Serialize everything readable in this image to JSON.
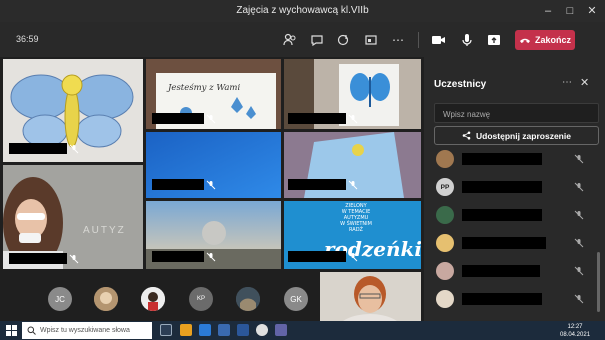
{
  "window": {
    "title": "Zajęcia z wychowawcą kl.VIIb"
  },
  "meeting": {
    "elapsed": "36:59",
    "leave_label": "Zakończ"
  },
  "panel": {
    "title": "Uczestnicy",
    "search_placeholder": "Wpisz nazwę",
    "share_label": "Udostępnij zaproszenie",
    "participants": [
      {
        "initials": ""
      },
      {
        "initials": "PP"
      },
      {
        "initials": ""
      },
      {
        "initials": ""
      },
      {
        "initials": ""
      },
      {
        "initials": ""
      }
    ]
  },
  "tiles": {
    "drawing_text": "Jesteśmy z Wami",
    "autyz_text": "AUTYZ",
    "poster_lines": [
      "ZIELONY",
      "W TEMACIE",
      "AUTYZMU",
      "W ŚWIETNIM",
      "RADŹ"
    ],
    "poster_big": "rodzeńki"
  },
  "avatars": [
    {
      "initials": "JC"
    },
    {
      "initials": ""
    },
    {
      "initials": ""
    },
    {
      "initials": "KP"
    },
    {
      "initials": ""
    },
    {
      "initials": "GK"
    }
  ],
  "taskbar": {
    "search_placeholder": "Wpisz tu wyszukiwane słowa",
    "time": "12:27",
    "date": "08.04.2021"
  },
  "colors": {
    "accent_red": "#c4314b",
    "panel_bg": "#292929",
    "stage_bg": "#1f1f1f",
    "teams_purple": "#6264a7"
  }
}
